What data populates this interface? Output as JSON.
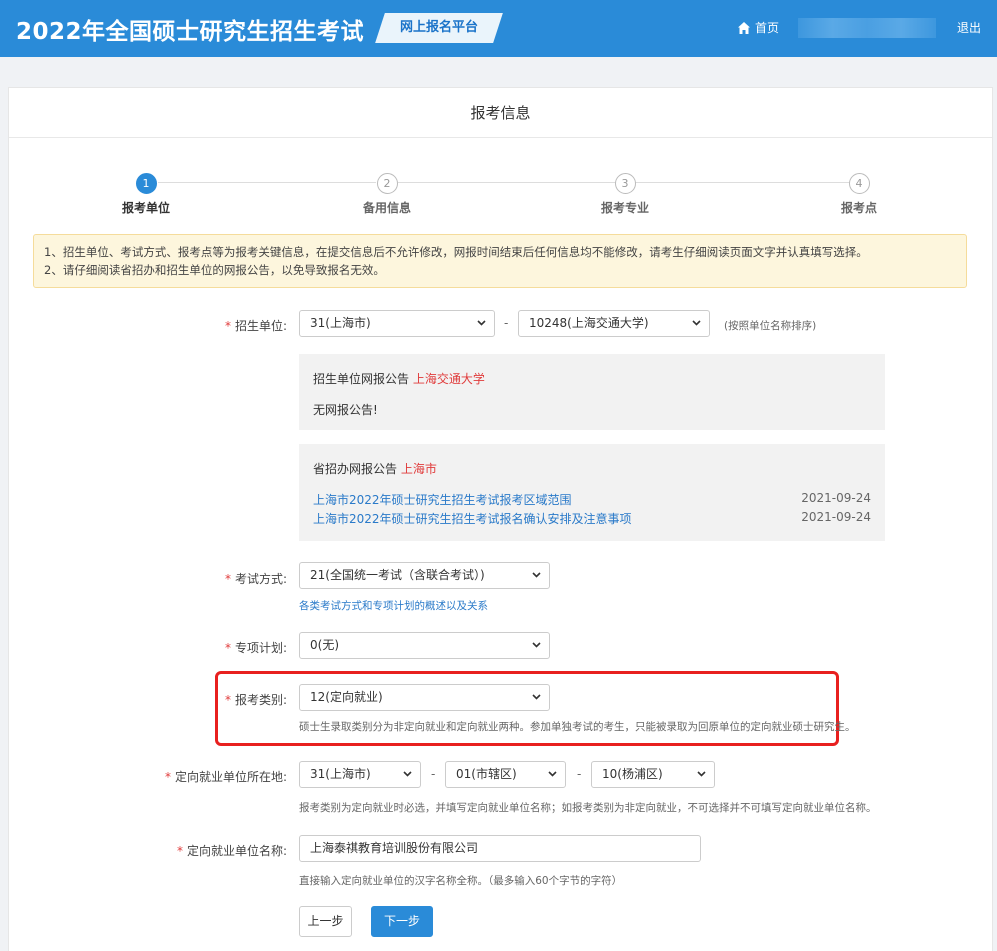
{
  "header": {
    "title": "2022年全国硕士研究生招生考试",
    "platform": "网上报名平台",
    "home": "首页",
    "logout": "退出"
  },
  "panel": {
    "title": "报考信息"
  },
  "steps": [
    {
      "num": "1",
      "label": "报考单位"
    },
    {
      "num": "2",
      "label": "备用信息"
    },
    {
      "num": "3",
      "label": "报考专业"
    },
    {
      "num": "4",
      "label": "报考点"
    }
  ],
  "notice": {
    "line1": "1、招生单位、考试方式、报考点等为报考关键信息，在提交信息后不允许修改，网报时间结束后任何信息均不能修改，请考生仔细阅读页面文字并认真填写选择。",
    "line2": "2、请仔细阅读省招办和招生单位的网报公告，以免导致报名无效。"
  },
  "form": {
    "required_mark": "*",
    "unit": {
      "label": "招生单位:",
      "province": "31(上海市)",
      "school": "10248(上海交通大学)",
      "sort_hint": "(按照单位名称排序)"
    },
    "unit_notice": {
      "title": "招生单位网报公告",
      "title_red": "上海交通大学",
      "text": "无网报公告!"
    },
    "prov_notice": {
      "title": "省招办网报公告",
      "title_red": "上海市",
      "items": [
        {
          "text": "上海市2022年硕士研究生招生考试报考区域范围",
          "date": "2021-09-24"
        },
        {
          "text": "上海市2022年硕士研究生招生考试报名确认安排及注意事项",
          "date": "2021-09-24"
        }
      ]
    },
    "exam_mode": {
      "label": "考试方式:",
      "value": "21(全国统一考试（含联合考试）)",
      "hint": "各类考试方式和专项计划的概述以及关系"
    },
    "special_plan": {
      "label": "专项计划:",
      "value": "0(无)"
    },
    "category": {
      "label": "报考类别:",
      "value": "12(定向就业)",
      "hint": "硕士生录取类别分为非定向就业和定向就业两种。参加单独考试的考生，只能被录取为回原单位的定向就业硕士研究生。"
    },
    "employer_location": {
      "label": "定向就业单位所在地:",
      "province": "31(上海市)",
      "city": "01(市辖区)",
      "district": "10(杨浦区)",
      "hint": "报考类别为定向就业时必选，并填写定向就业单位名称；如报考类别为非定向就业，不可选择并不可填写定向就业单位名称。"
    },
    "employer_name": {
      "label": "定向就业单位名称:",
      "value": "上海泰祺教育培训股份有限公司",
      "hint": "直接输入定向就业单位的汉字名称全称。（最多输入60个字节的字符）"
    },
    "dash": "-",
    "prev_button": "上一步",
    "next_button": "下一步"
  }
}
